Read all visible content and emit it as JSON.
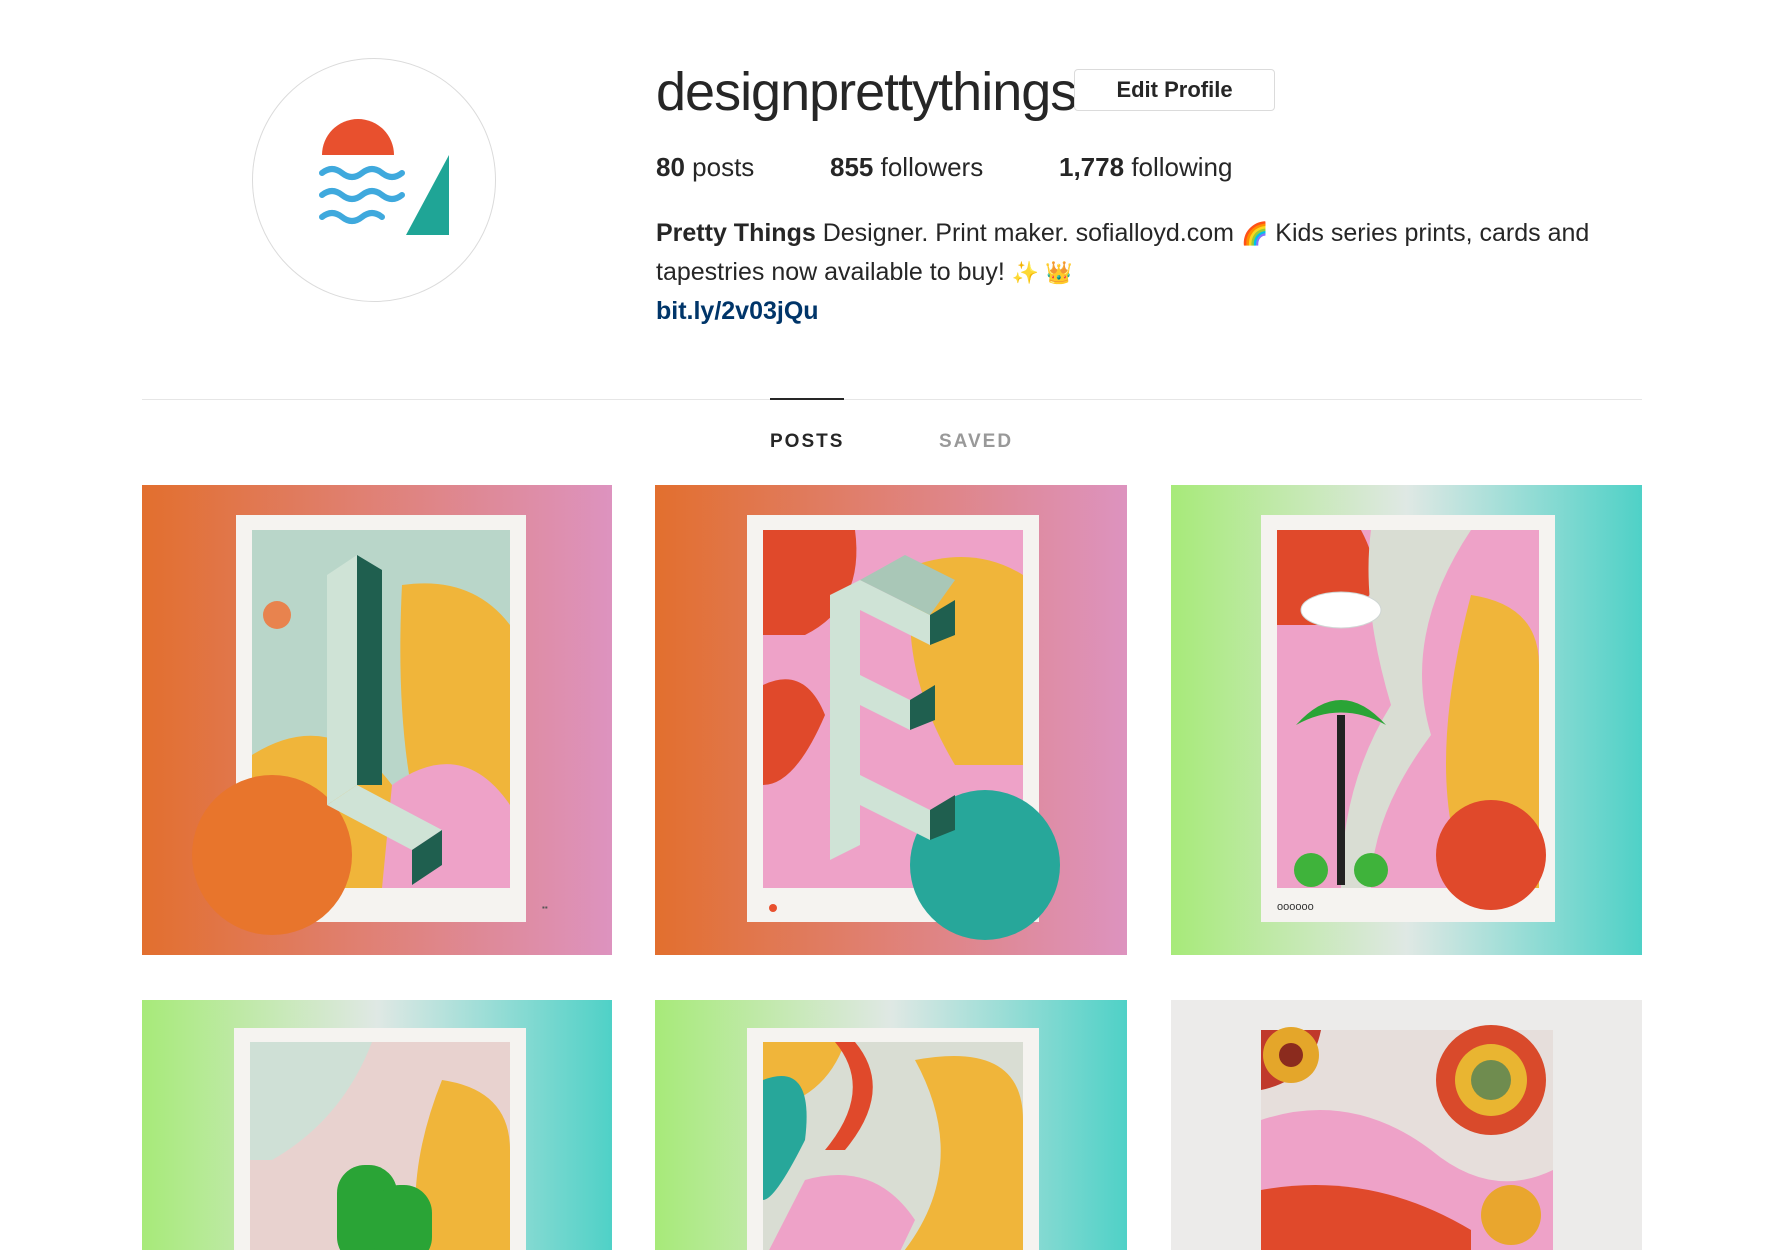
{
  "profile": {
    "username": "designprettythings",
    "edit_label": "Edit Profile",
    "avatar_icon": "sun-waves-triangle-logo"
  },
  "stats": {
    "posts_count": "80",
    "posts_label": "posts",
    "followers_count": "855",
    "followers_label": "followers",
    "following_count": "1,778",
    "following_label": "following"
  },
  "bio": {
    "name": "Pretty Things",
    "text1": "Designer. Print maker. sofialloyd.com",
    "emoji1": "🌈",
    "text2": " Kids series prints, cards and tapestries now available to buy!",
    "emoji2": "✨ 👑",
    "link": "bit.ly/2v03jQu"
  },
  "tabs": {
    "posts": "POSTS",
    "saved": "SAVED"
  },
  "posts": [
    {
      "id": "post-1",
      "subject": "letter-L-print"
    },
    {
      "id": "post-2",
      "subject": "letter-E-print"
    },
    {
      "id": "post-3",
      "subject": "palm-tree-print",
      "caption": "oooooo"
    },
    {
      "id": "post-4",
      "subject": "green-cactus-print"
    },
    {
      "id": "post-5",
      "subject": "abstract-shapes-print"
    },
    {
      "id": "post-6",
      "subject": "pressed-flowers-print"
    }
  ]
}
